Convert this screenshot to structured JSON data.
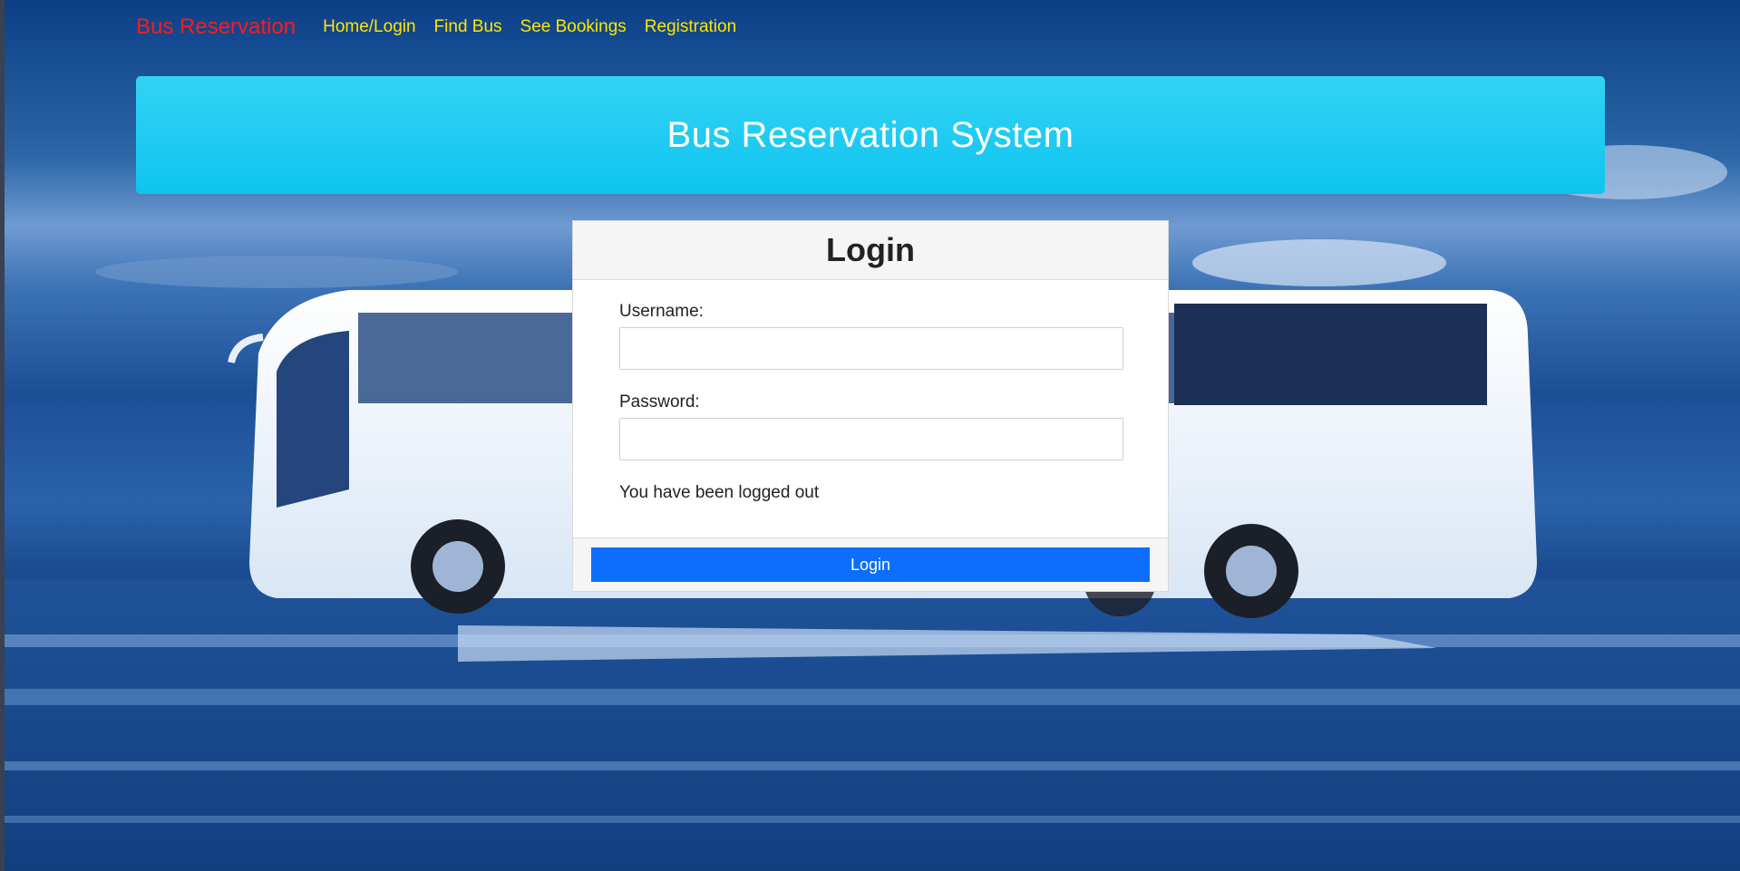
{
  "navbar": {
    "brand": "Bus Reservation",
    "links": [
      "Home/Login",
      "Find Bus",
      "See Bookings",
      "Registration"
    ]
  },
  "banner": {
    "title": "Bus Reservation System"
  },
  "login": {
    "title": "Login",
    "username_label": "Username:",
    "password_label": "Password:",
    "username_value": "",
    "password_value": "",
    "message": "You have been logged out",
    "submit_label": "Login"
  },
  "colors": {
    "brand": "#ff1a1a",
    "nav_link": "#ffe600",
    "banner": "#1ac9f1",
    "button": "#0d6efd"
  }
}
